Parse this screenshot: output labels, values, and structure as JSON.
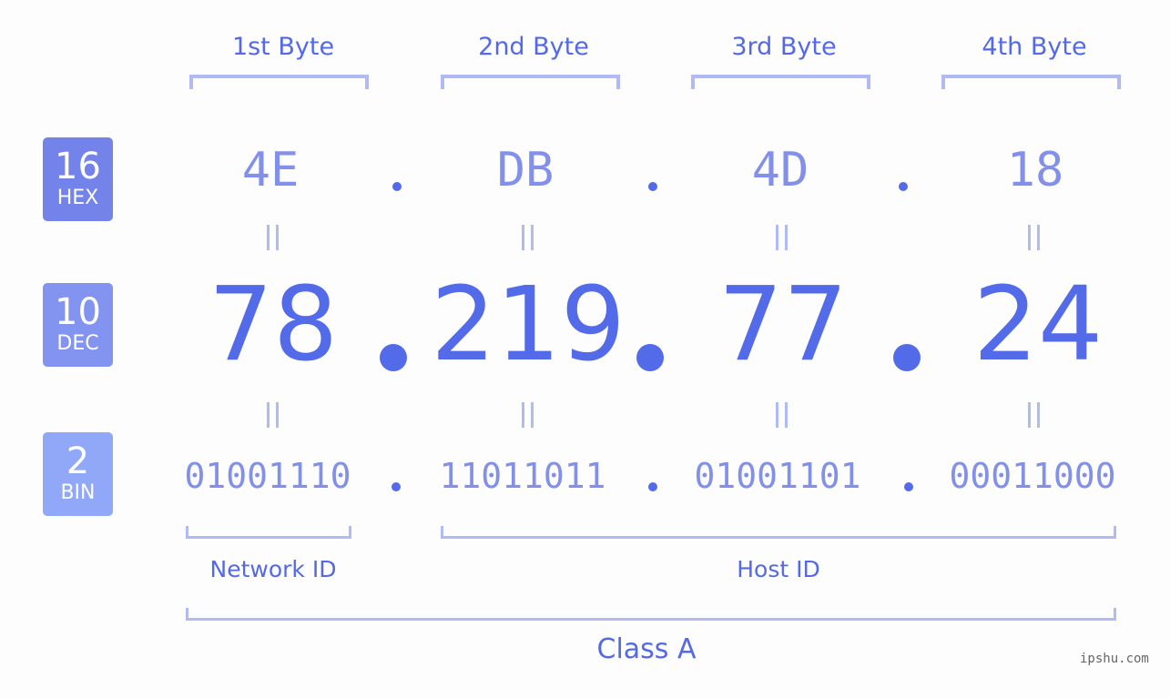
{
  "colors": {
    "accent": "#536be9",
    "hex_badge": "#7383ea",
    "dec_badge": "#8294f0",
    "bin_badge": "#90a8f7",
    "bracket": "#b1baf3"
  },
  "badges": [
    {
      "base": "16",
      "label": "HEX"
    },
    {
      "base": "10",
      "label": "DEC"
    },
    {
      "base": "2",
      "label": "BIN"
    }
  ],
  "bytes": [
    {
      "header": "1st Byte",
      "hex": "4E",
      "dec": "78",
      "bin": "01001110"
    },
    {
      "header": "2nd Byte",
      "hex": "DB",
      "dec": "219",
      "bin": "11011011"
    },
    {
      "header": "3rd Byte",
      "hex": "4D",
      "dec": "77",
      "bin": "01001101"
    },
    {
      "header": "4th Byte",
      "hex": "18",
      "dec": "24",
      "bin": "00011000"
    }
  ],
  "equals_sign": "=",
  "segments": {
    "network": "Network ID",
    "host": "Host ID",
    "class": "Class A"
  },
  "watermark": "ipshu.com"
}
